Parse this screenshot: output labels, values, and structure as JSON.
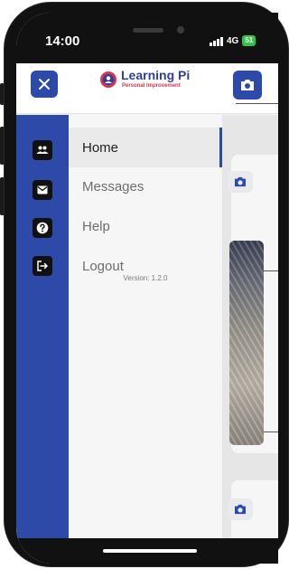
{
  "status_bar": {
    "time": "14:00",
    "network": "4G",
    "battery": "51"
  },
  "header": {
    "logo": {
      "title": "Learning Pi",
      "subtitle": "Personal Improvement"
    },
    "close_icon": "close-icon",
    "camera_icon": "camera-icon"
  },
  "drawer": {
    "rail_icons": [
      "people-icon",
      "mail-icon",
      "help-icon",
      "logout-icon"
    ],
    "menu": [
      {
        "label": "Home",
        "active": true
      },
      {
        "label": "Messages",
        "active": false
      },
      {
        "label": "Help",
        "active": false
      },
      {
        "label": "Logout",
        "active": false
      }
    ],
    "version": "Version: 1.2.0"
  },
  "colors": {
    "brand": "#2e4aa8",
    "accent": "#d9334a",
    "battery": "#36c24a"
  }
}
